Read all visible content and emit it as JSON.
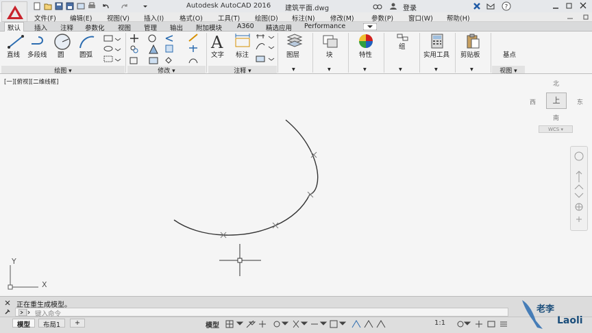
{
  "titlebar": {
    "app_title": "Autodesk AutoCAD 2016",
    "file_name": "建筑平面.dwg",
    "login_label": "登录"
  },
  "menubar": {
    "items": [
      "文件(F)",
      "编辑(E)",
      "视图(V)",
      "插入(I)",
      "格式(O)",
      "工具(T)",
      "绘图(D)",
      "标注(N)",
      "修改(M)",
      "参数(P)",
      "窗口(W)",
      "帮助(H)"
    ]
  },
  "tabs": {
    "items": [
      "默认",
      "插入",
      "注释",
      "参数化",
      "视图",
      "管理",
      "输出",
      "附加模块",
      "A360",
      "精选应用",
      "Performance"
    ],
    "active": "默认"
  },
  "ribbon": {
    "draw": {
      "line": "直线",
      "polyline": "多段线",
      "circle": "圆",
      "arc": "圆弧",
      "title": "绘图"
    },
    "modify": {
      "title": "修改"
    },
    "annotation": {
      "text": "文字",
      "dimension": "标注",
      "title": "注释"
    },
    "layers": {
      "label": "图层"
    },
    "block": {
      "label": "块"
    },
    "properties": {
      "label": "特性"
    },
    "groups": {
      "label": "组"
    },
    "utilities": {
      "label": "实用工具"
    },
    "clipboard": {
      "label": "剪贴板"
    },
    "view": {
      "base": "基点",
      "title": "视图"
    }
  },
  "viewport": {
    "label": "[一][俯视][二维线框]"
  },
  "viewcube": {
    "north": "北",
    "south": "南",
    "east": "东",
    "west": "西",
    "top_face": "上",
    "wcs": "WCS"
  },
  "ucs": {
    "x": "X",
    "y": "Y"
  },
  "command": {
    "history": "正在重生成模型。",
    "placeholder": "键入命令"
  },
  "layout_tabs": [
    "模型",
    "布局1",
    "+"
  ],
  "statusbar": {
    "model": "模型",
    "scale": "1:1"
  },
  "watermark": {
    "name": "老李",
    "brand": "Laoli"
  },
  "colors": {
    "app_red": "#c8232c",
    "accent_blue": "#2b6cb0",
    "ribbon_bg": "#f4f4f4",
    "canvas_bg": "#f5f5f5"
  }
}
